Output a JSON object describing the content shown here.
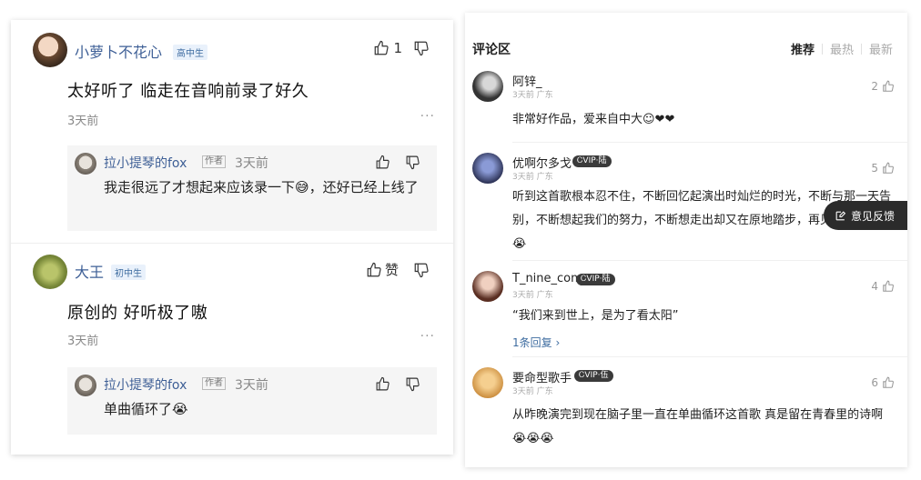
{
  "left_panel": {
    "comments": [
      {
        "user": "小萝卜不花心",
        "badge": "高中生",
        "content": "太好听了 临走在音响前录了好久",
        "time": "3天前",
        "like_count": "1",
        "more": "···",
        "reply": {
          "user": "拉小提琴的fox",
          "tag": "作者",
          "time": "3天前",
          "text": "我走很远了才想起来应该录一下😅，还好已经上线了"
        }
      },
      {
        "user": "大王",
        "badge": "初中生",
        "content": "原创的 好听极了嗷",
        "time": "3天前",
        "like_label": "赞",
        "more": "···",
        "reply": {
          "user": "拉小提琴的fox",
          "tag": "作者",
          "time": "3天前",
          "text": "单曲循环了😭"
        }
      }
    ]
  },
  "right_panel": {
    "title": "评论区",
    "sort_tabs": [
      "推荐",
      "最热",
      "最新"
    ],
    "active_sort": "推荐",
    "comments": [
      {
        "user": "阿锌_",
        "vip": "",
        "meta": "3天前 广东",
        "likes": "2",
        "text": "非常好作品，爱来自中大☺❤❤"
      },
      {
        "user": "优啊尔多戈",
        "vip": "ᏟVIP·陆",
        "meta": "3天前 广东",
        "likes": "5",
        "text": "听到这首歌根本忍不住，不断回忆起演出时灿烂的时光，不断与那一天告别，不断想起我们的努力，不断想走出却又在原地踏步，再见的吧😭😭😭"
      },
      {
        "user": "T_nine_com",
        "vip": "ᏟVIP·陆",
        "meta": "3天前 广东",
        "likes": "4",
        "text": "“我们来到世上，是为了看太阳”",
        "sub": "1条回复 ›"
      },
      {
        "user": "要命型歌手",
        "vip": "ᏟVIP·伍",
        "meta": "3天前 广东",
        "likes": "6",
        "text": "从昨晚演完到现在脑子里一直在单曲循环这首歌 真是留在青春里的诗啊😭😭😭"
      }
    ],
    "feedback_label": "意见反馈"
  },
  "colors": {
    "username_blue": "#3e5f96",
    "badge_bg": "#e9f1fb",
    "reply_bg": "#f5f5f5",
    "feedback_bg": "#2b2b2b"
  },
  "icons": [
    "thumbs-up-icon",
    "thumbs-down-icon",
    "more-icon",
    "edit-icon",
    "chevron-right-icon"
  ]
}
